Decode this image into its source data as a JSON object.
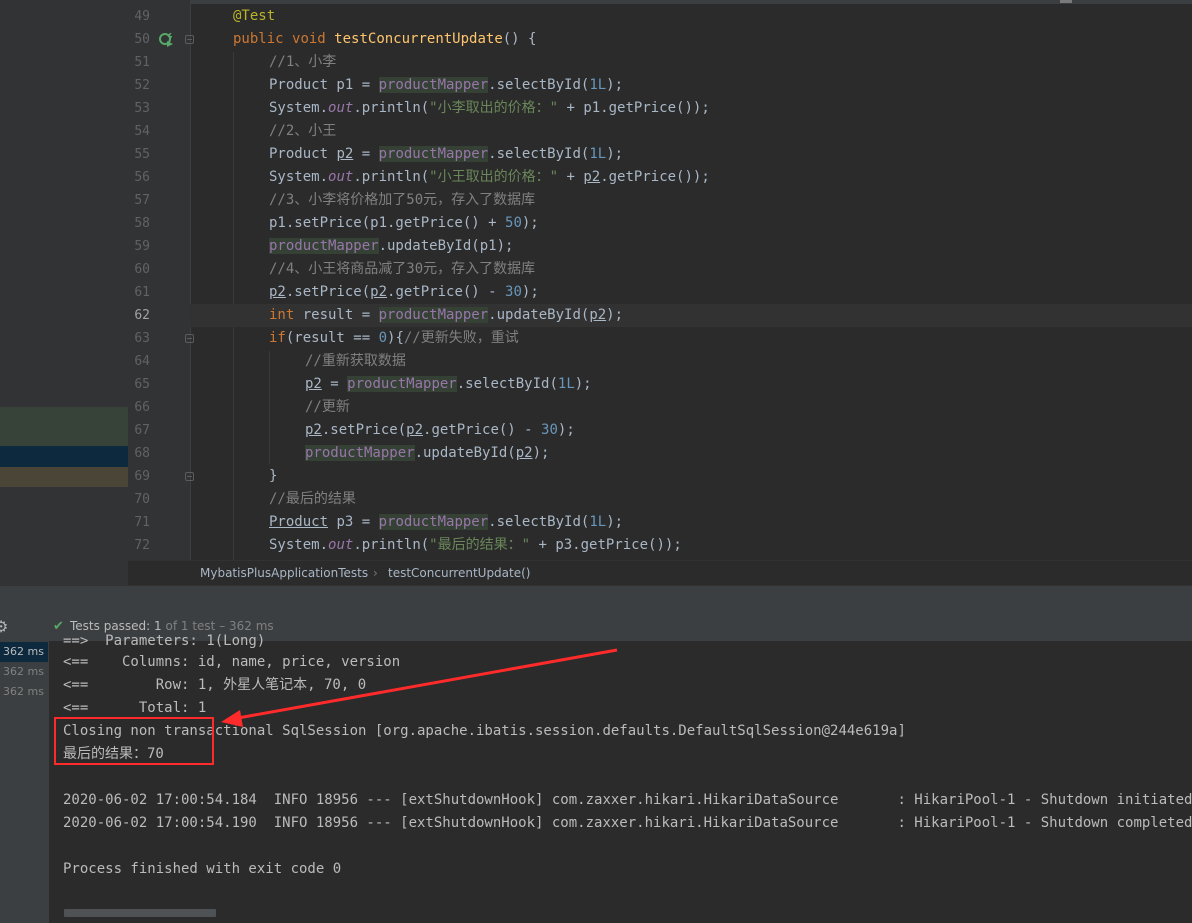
{
  "editor": {
    "lines": [
      {
        "num": "49",
        "indent": 1,
        "tokens": [
          [
            "ann",
            "@Test"
          ]
        ]
      },
      {
        "num": "50",
        "indent": 1,
        "tokens": [
          [
            "kw",
            "public "
          ],
          [
            "kw",
            "void "
          ],
          [
            "fn",
            "testConcurrentUpdate"
          ],
          [
            "p",
            "() {"
          ]
        ]
      },
      {
        "num": "51",
        "indent": 2,
        "tokens": [
          [
            "cm",
            "//1、小李"
          ]
        ]
      },
      {
        "num": "52",
        "indent": 2,
        "tokens": [
          [
            "p",
            "Product p1 = "
          ],
          [
            "fld",
            "productMapper"
          ],
          [
            "p",
            ".selectById("
          ],
          [
            "nm",
            "1L"
          ],
          [
            "p",
            ");"
          ]
        ]
      },
      {
        "num": "53",
        "indent": 2,
        "tokens": [
          [
            "p",
            "System."
          ],
          [
            "sf",
            "out"
          ],
          [
            "p",
            ".println("
          ],
          [
            "st",
            "\"小李取出的价格：\""
          ],
          [
            "p",
            " + p1.getPrice());"
          ]
        ]
      },
      {
        "num": "54",
        "indent": 2,
        "tokens": [
          [
            "cm",
            "//2、小王"
          ]
        ]
      },
      {
        "num": "55",
        "indent": 2,
        "tokens": [
          [
            "p",
            "Product "
          ],
          [
            "ul",
            "p2"
          ],
          [
            "p",
            " = "
          ],
          [
            "fld",
            "productMapper"
          ],
          [
            "p",
            ".selectById("
          ],
          [
            "nm",
            "1L"
          ],
          [
            "p",
            ");"
          ]
        ]
      },
      {
        "num": "56",
        "indent": 2,
        "tokens": [
          [
            "p",
            "System."
          ],
          [
            "sf",
            "out"
          ],
          [
            "p",
            ".println("
          ],
          [
            "st",
            "\"小王取出的价格：\""
          ],
          [
            "p",
            " + "
          ],
          [
            "ul",
            "p2"
          ],
          [
            "p",
            ".getPrice());"
          ]
        ]
      },
      {
        "num": "57",
        "indent": 2,
        "tokens": [
          [
            "cm",
            "//3、小李将价格加了50元，存入了数据库"
          ]
        ]
      },
      {
        "num": "58",
        "indent": 2,
        "tokens": [
          [
            "p",
            "p1.setPrice(p1.getPrice() + "
          ],
          [
            "nm",
            "50"
          ],
          [
            "p",
            ");"
          ]
        ]
      },
      {
        "num": "59",
        "indent": 2,
        "tokens": [
          [
            "fld",
            "productMapper"
          ],
          [
            "p",
            ".updateById(p1);"
          ]
        ]
      },
      {
        "num": "60",
        "indent": 2,
        "tokens": [
          [
            "cm",
            "//4、小王将商品减了30元，存入了数据库"
          ]
        ]
      },
      {
        "num": "61",
        "indent": 2,
        "tokens": [
          [
            "ul",
            "p2"
          ],
          [
            "p",
            ".setPrice("
          ],
          [
            "ul",
            "p2"
          ],
          [
            "p",
            ".getPrice() - "
          ],
          [
            "nm",
            "30"
          ],
          [
            "p",
            ");"
          ]
        ]
      },
      {
        "num": "62",
        "indent": 2,
        "current": true,
        "tokens": [
          [
            "kw",
            "int "
          ],
          [
            "p",
            "result = "
          ],
          [
            "fld",
            "productMapper"
          ],
          [
            "p",
            ".updateById("
          ],
          [
            "ul",
            "p2"
          ],
          [
            "p",
            ");"
          ]
        ]
      },
      {
        "num": "63",
        "indent": 2,
        "tokens": [
          [
            "kw",
            "if"
          ],
          [
            "p",
            "(result == "
          ],
          [
            "nm",
            "0"
          ],
          [
            "p",
            "){"
          ],
          [
            "cm",
            "//更新失败，重试"
          ]
        ]
      },
      {
        "num": "64",
        "indent": 3,
        "tokens": [
          [
            "cm",
            "//重新获取数据"
          ]
        ]
      },
      {
        "num": "65",
        "indent": 3,
        "tokens": [
          [
            "ul",
            "p2"
          ],
          [
            "p",
            " = "
          ],
          [
            "fld",
            "productMapper"
          ],
          [
            "p",
            ".selectById("
          ],
          [
            "nm",
            "1L"
          ],
          [
            "p",
            ");"
          ]
        ]
      },
      {
        "num": "66",
        "indent": 3,
        "tokens": [
          [
            "cm",
            "//更新"
          ]
        ]
      },
      {
        "num": "67",
        "indent": 3,
        "tokens": [
          [
            "ul",
            "p2"
          ],
          [
            "p",
            ".setPrice("
          ],
          [
            "ul",
            "p2"
          ],
          [
            "p",
            ".getPrice() - "
          ],
          [
            "nm",
            "30"
          ],
          [
            "p",
            ");"
          ]
        ]
      },
      {
        "num": "68",
        "indent": 3,
        "tokens": [
          [
            "fld",
            "productMapper"
          ],
          [
            "p",
            ".updateById("
          ],
          [
            "ul",
            "p2"
          ],
          [
            "p",
            ");"
          ]
        ]
      },
      {
        "num": "69",
        "indent": 2,
        "tokens": [
          [
            "p",
            "}"
          ]
        ]
      },
      {
        "num": "70",
        "indent": 2,
        "tokens": [
          [
            "cm",
            "//最后的结果"
          ]
        ]
      },
      {
        "num": "71",
        "indent": 2,
        "tokens": [
          [
            "ul",
            "Product"
          ],
          [
            "p",
            " p3 = "
          ],
          [
            "fld",
            "productMapper"
          ],
          [
            "p",
            ".selectById("
          ],
          [
            "nm",
            "1L"
          ],
          [
            "p",
            ");"
          ]
        ]
      },
      {
        "num": "72",
        "indent": 2,
        "tokens": [
          [
            "p",
            "System."
          ],
          [
            "sf",
            "out"
          ],
          [
            "p",
            ".println("
          ],
          [
            "st",
            "\"最后的结果：\""
          ],
          [
            "p",
            " + p3.getPrice());"
          ]
        ]
      }
    ]
  },
  "breadcrumb": {
    "class_name": "MybatisPlusApplicationTests",
    "separator": "›",
    "method_name": "testConcurrentUpdate()"
  },
  "run_bar": {
    "status_label": "Tests passed:",
    "passed_count": "1",
    "detail": "of 1 test – 362 ms"
  },
  "test_tree": {
    "times": [
      "362 ms",
      "362 ms",
      "362 ms"
    ]
  },
  "console": {
    "lines": [
      "==>  Parameters: 1(Long)",
      "<==    Columns: id, name, price, version",
      "<==        Row: 1, 外星人笔记本, 70, 0",
      "<==      Total: 1",
      "Closing non transactional SqlSession [org.apache.ibatis.session.defaults.DefaultSqlSession@244e619a]",
      "最后的结果：70",
      "",
      "2020-06-02 17:00:54.184  INFO 18956 --- [extShutdownHook] com.zaxxer.hikari.HikariDataSource       : HikariPool-1 - Shutdown initiated...",
      "2020-06-02 17:00:54.190  INFO 18956 --- [extShutdownHook] com.zaxxer.hikari.HikariDataSource       : HikariPool-1 - Shutdown completed.",
      "",
      "Process finished with exit code 0"
    ]
  },
  "colors": {
    "annotation_box": "#ff2a2a",
    "passed_check": "#59a869",
    "current_line": "#323232"
  }
}
